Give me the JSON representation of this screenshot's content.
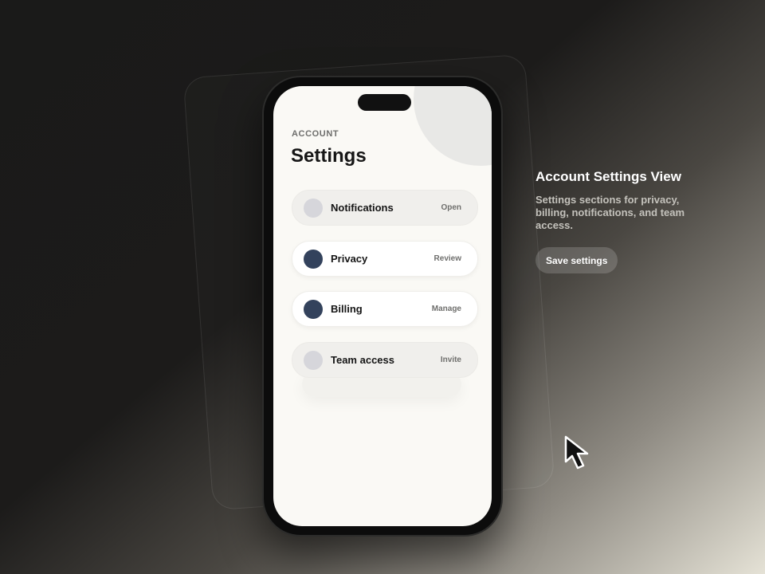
{
  "screen": {
    "eyebrow": "ACCOUNT",
    "title": "Settings",
    "items": [
      {
        "label": "Notifications",
        "action": "Open",
        "state": "muted"
      },
      {
        "label": "Privacy",
        "action": "Review",
        "state": "active"
      },
      {
        "label": "Billing",
        "action": "Manage",
        "state": "active"
      },
      {
        "label": "Team access",
        "action": "Invite",
        "state": "muted"
      }
    ]
  },
  "info": {
    "title": "Account Settings View",
    "description": "Settings sections for privacy, billing, notifications, and team access.",
    "button_label": "Save settings"
  },
  "icons": {
    "cursor": "mouse-pointer-icon"
  },
  "colors": {
    "accent_dot": "#33425c",
    "muted_dot": "#d6d6db",
    "screen_bg": "#faf9f5"
  }
}
